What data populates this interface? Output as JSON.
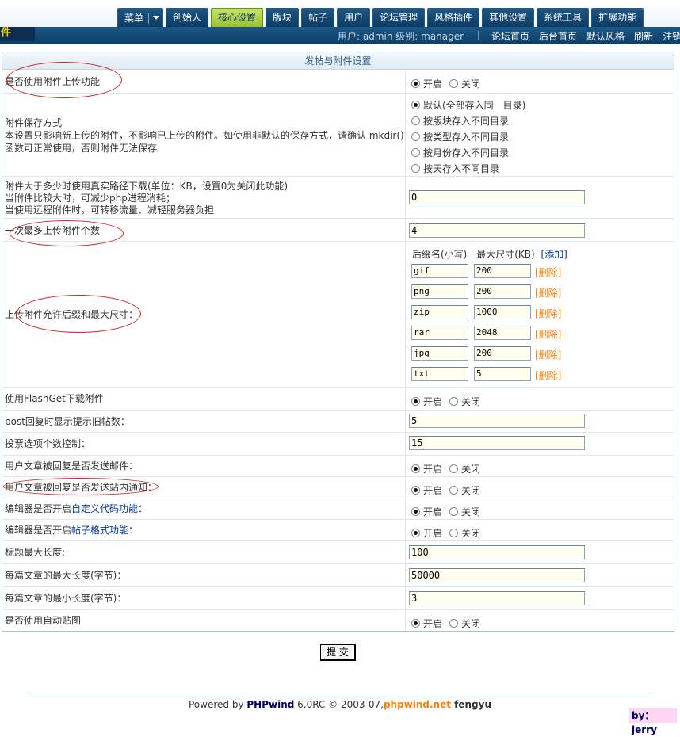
{
  "nav": {
    "menu_label": "菜单",
    "tabs": [
      "创始人",
      "核心设置",
      "版块",
      "帖子",
      "用户",
      "论坛管理",
      "风格插件",
      "其他设置",
      "系统工具",
      "扩展功能"
    ],
    "active_tab": "核心设置"
  },
  "header": {
    "section_title": "件",
    "user_info": "用户: admin 级别: manager",
    "separator": "|",
    "links": [
      "论坛首页",
      "后台首页",
      "默认风格",
      "刷新",
      "注销"
    ]
  },
  "panel": {
    "title": "发帖与附件设置"
  },
  "settings": {
    "attach_upload": {
      "label": "是否使用附件上传功能",
      "options": [
        "开启",
        "关闭"
      ],
      "selected": "开启"
    },
    "attach_save": {
      "label": "附件保存方式",
      "desc_1": "本设置只影响新上传的附件，不影响已上传的附件。如使用非默认的保存方式，请确认 mkdir()",
      "desc_2": "函数可正常使用，否则附件无法保存",
      "options": [
        "默认(全部存入同一目录)",
        "按版块存入不同目录",
        "按类型存入不同目录",
        "按月份存入不同目录",
        "按天存入不同目录"
      ],
      "selected": "默认(全部存入同一目录)"
    },
    "attach_realpath": {
      "desc_1": "附件大于多少时使用真实路径下载(单位：KB，设置0为关闭此功能)",
      "desc_2": "当附件比较大时，可减少php进程消耗；",
      "desc_3": "当使用远程附件时，可转移流量、减轻服务器负担",
      "value": "0"
    },
    "max_uploads": {
      "label": "一次最多上传附件个数",
      "value": "4"
    },
    "allowed_ext": {
      "label": "上传附件允许后缀和最大尺寸：",
      "col_ext": "后缀名(小写)",
      "col_size": "最大尺寸(KB)",
      "add_label": "[添加]",
      "delete_label": "[删除]",
      "rows": [
        {
          "ext": "gif",
          "size": "200"
        },
        {
          "ext": "png",
          "size": "200"
        },
        {
          "ext": "zip",
          "size": "1000"
        },
        {
          "ext": "rar",
          "size": "2048"
        },
        {
          "ext": "jpg",
          "size": "200"
        },
        {
          "ext": "txt",
          "size": "5"
        }
      ]
    },
    "flashget": {
      "label": "使用FlashGet下载附件",
      "options": [
        "开启",
        "关闭"
      ],
      "selected": "开启"
    },
    "post_reply_count": {
      "label": "post回复时显示提示旧帖数：",
      "value": "5"
    },
    "vote_options": {
      "label": "投票选项个数控制：",
      "value": "15"
    },
    "reply_email": {
      "label": "用户文章被回复是否发送邮件：",
      "options": [
        "开启",
        "关闭"
      ],
      "selected": "开启"
    },
    "reply_message": {
      "label": "用户文章被回复是否发送站内通知：",
      "options": [
        "开启",
        "关闭"
      ],
      "selected": "开启"
    },
    "editor_custom_code": {
      "label_prefix": "编辑器是否开启",
      "label_link": "自定义代码功能",
      "label_suffix": "：",
      "options": [
        "开启",
        "关闭"
      ],
      "selected": "开启"
    },
    "editor_post_format": {
      "label_prefix": "编辑器是否开启",
      "label_link": "帖子格式功能",
      "label_suffix": "：",
      "options": [
        "开启",
        "关闭"
      ],
      "selected": "开启"
    },
    "title_max": {
      "label": "标题最大长度:",
      "value": "100"
    },
    "post_max": {
      "label": "每篇文章的最大长度(字节)：",
      "value": "50000"
    },
    "post_min": {
      "label": "每篇文章的最小长度(字节)：",
      "value": "3"
    },
    "auto_image": {
      "label": "是否使用自动贴图",
      "options": [
        "开启",
        "关闭"
      ],
      "selected": "开启"
    }
  },
  "submit_label": "提 交",
  "footer": {
    "prefix": "Powered by ",
    "brand": "PHPwind",
    "version": " 6.0RC © 2003-07,",
    "site": "phpwind.net",
    "author": " fengyu"
  },
  "by_tag": "by：jerry",
  "colors": {
    "accent_blue": "#0d3e67",
    "active_tab_green": "#9ac12f",
    "link_blue": "#0033aa",
    "delete_orange": "#ff7f00",
    "annotation_red": "#d42020"
  }
}
